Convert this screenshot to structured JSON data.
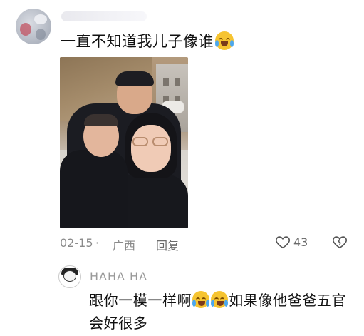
{
  "comment": {
    "username": "",
    "text": "一直不知道我儿子像谁",
    "emoji": "crying-laughing-emoji",
    "date": "02-15",
    "separator": "·",
    "region": "广西",
    "reply_label": "回复",
    "like_count": "43"
  },
  "reply": {
    "username": "HAHA HA",
    "text_before": "跟你一模一样啊",
    "emoji_count": 2,
    "text_after": "如果像他爸爸五官会好很多"
  },
  "colors": {
    "background": "#ffffff",
    "text": "#111111",
    "meta": "#8a8a8a",
    "emoji": "#f6c431"
  },
  "icons": {
    "like": "heart-outline-icon",
    "dislike": "broken-heart-outline-icon"
  }
}
